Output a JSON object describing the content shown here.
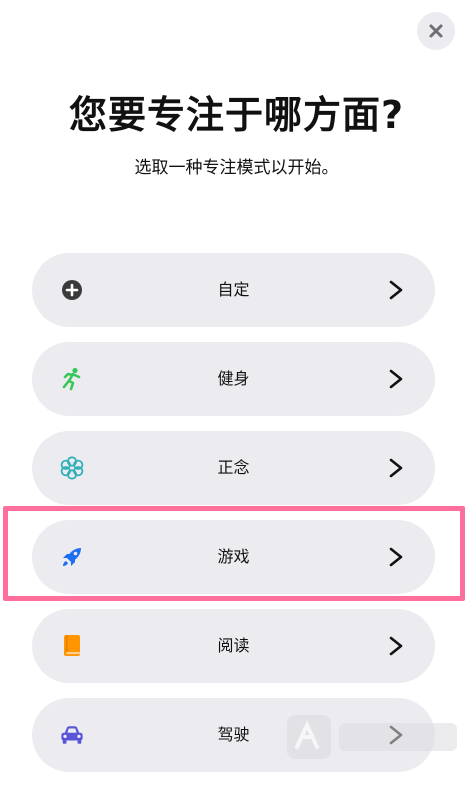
{
  "header": {
    "title": "您要专注于哪方面?",
    "subtitle": "选取一种专注模式以开始。",
    "close_icon": "close-icon"
  },
  "options": [
    {
      "label": "自定",
      "icon": "plus-circle-icon",
      "color": "#3a3a3c"
    },
    {
      "label": "健身",
      "icon": "running-person-icon",
      "color": "#34c759"
    },
    {
      "label": "正念",
      "icon": "flower-icon",
      "color": "#30b0b8"
    },
    {
      "label": "游戏",
      "icon": "rocket-icon",
      "color": "#1e6ef5"
    },
    {
      "label": "阅读",
      "icon": "book-icon",
      "color": "#ff9500"
    },
    {
      "label": "驾驶",
      "icon": "car-icon",
      "color": "#5856d6"
    }
  ],
  "highlight_color": "#ff6f9c"
}
